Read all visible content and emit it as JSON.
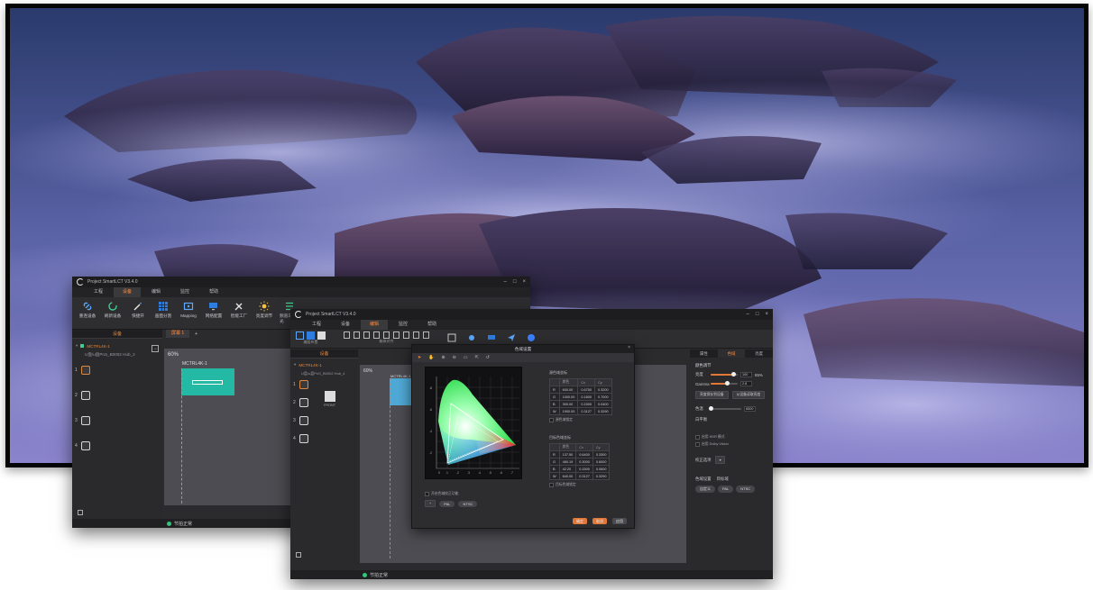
{
  "back_window": {
    "title": "Project SmartLCT V3.4.0",
    "menu": [
      "工程",
      "设备",
      "编辑",
      "监控",
      "帮助"
    ],
    "active_menu": 1,
    "ribbon": [
      {
        "label": "重连设备",
        "icon": "link-icon"
      },
      {
        "label": "刷新设备",
        "icon": "refresh-icon"
      },
      {
        "label": "快捷开",
        "icon": "wand-icon"
      },
      {
        "label": "画面分割",
        "icon": "grid-icon"
      },
      {
        "label": "Mapping",
        "icon": "mapping-icon"
      },
      {
        "label": "网络配置",
        "icon": "monitor-icon"
      },
      {
        "label": "智能工厂",
        "icon": "tools-icon"
      },
      {
        "label": "亮度调节",
        "icon": "brightness-icon"
      },
      {
        "label": "频道与调光",
        "icon": "list-icon"
      }
    ],
    "left_panel": {
      "header": "设备",
      "tree_root": "MCTRL4K-1",
      "tree_sub": "U盘/u盘PnS_B0002 Hub_2"
    },
    "tab": "屏幕 1",
    "zoom": "60%",
    "screen_label": "MCTRL4K-1",
    "status": "节拍正常"
  },
  "front_window": {
    "title": "Project SmartLCT V3.4.0",
    "menu": [
      "工程",
      "设备",
      "编辑",
      "监控",
      "帮助"
    ],
    "active_menu": 2,
    "ribbon_groups": [
      "编组布置",
      "箱体对齐"
    ],
    "ribbon_right": [
      {
        "label": "屏幕模组",
        "icon": "module-icon"
      },
      {
        "label": "画面",
        "icon": "picture-icon"
      },
      {
        "label": "亮度",
        "icon": "monitor-icon"
      },
      {
        "label": "发送",
        "icon": "send-icon"
      },
      {
        "label": "帮助",
        "icon": "help-icon"
      }
    ],
    "left_panel": {
      "header": "设备",
      "tree_root": "MCTRL4K-1",
      "tree_sub": "U盘/u盘PnS_B0002 Hub_4"
    },
    "layer_label": "FRONT",
    "zoom": "60%",
    "screen_label": "MCTRL4K-1",
    "status": "节拍正常",
    "dialog": {
      "title": "色域设置",
      "source_title": "源色域坐标",
      "source_headers": [
        "颜色",
        "Cx",
        "Cy"
      ],
      "source_rows": [
        [
          "R",
          "600.00",
          "0.6750",
          "0.3200"
        ],
        [
          "G",
          "1000.00",
          "0.1800",
          "0.7000"
        ],
        [
          "B",
          "300.00",
          "0.1500",
          "0.0400"
        ],
        [
          "W",
          "1900.00",
          "0.3127",
          "0.3290"
        ]
      ],
      "target_title": "目标色域坐标",
      "target_headers": [
        "颜色",
        "Cx",
        "Cy"
      ],
      "target_rows": [
        [
          "R",
          "137.50",
          "0.6400",
          "0.3300"
        ],
        [
          "G",
          "460.19",
          "0.3000",
          "0.6000"
        ],
        [
          "B",
          "42.20",
          "0.1500",
          "0.0600"
        ],
        [
          "W",
          "640.00",
          "0.3127",
          "0.3290"
        ]
      ],
      "checkbox_source": "源色域锁定",
      "checkbox_target": "目标色域锁定",
      "checkbox_bottom": "开启色域校正功能",
      "presets": [
        "PAL",
        "NTSC"
      ],
      "buttons": [
        "确定",
        "取消",
        "应用"
      ]
    },
    "right_panel": {
      "tabs": [
        "属性",
        "色域",
        "亮度"
      ],
      "active_tab": 1,
      "section": "颜色调节",
      "brightness_label": "亮度",
      "brightness_value": "100",
      "brightness_pct": "85%",
      "gamma_label": "Gamma",
      "gamma_value": "2.8",
      "btn_save": "亮度保存到设备",
      "btn_load": "从设备读取亮度",
      "color_temp_label": "色温",
      "color_temp_value": "6500",
      "white_balance": "白平衡",
      "checkbox_a": "启用 HDR 模式",
      "checkbox_b": "启用 Dolby Vision",
      "gamut_correction": "校正选项",
      "preset_section_a": "色域设置",
      "preset_section_b": "目标域",
      "preset_buttons": [
        "自定义",
        "PAL",
        "NTSC"
      ]
    }
  }
}
